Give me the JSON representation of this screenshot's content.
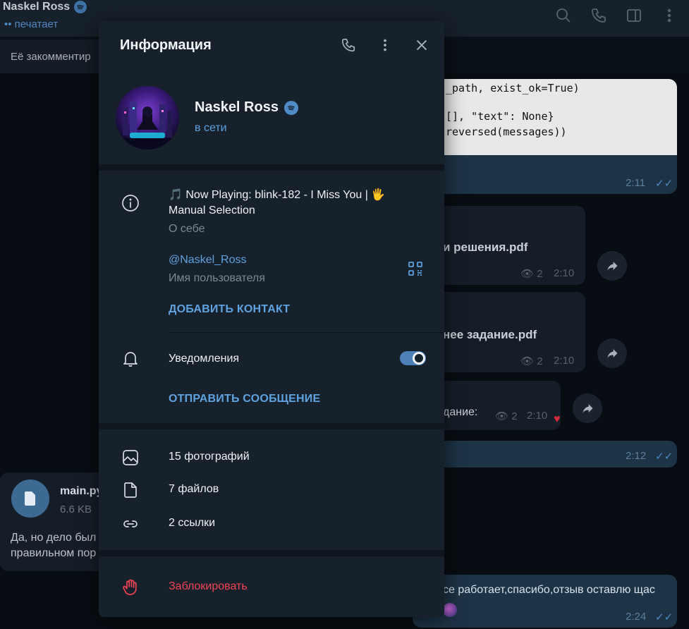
{
  "background": {
    "chat_title": "Naskel Ross",
    "chat_status": "•• печатает",
    "pinned_preview": "Её закомментир",
    "code_lines": [
      "_path, exist_ok=True)",
      "[], \"text\": None}",
      "reversed(messages))"
    ],
    "times": [
      "2:11",
      "2:10",
      "2:10",
      "2:10",
      "2:12",
      "2:24"
    ],
    "view_counts": [
      "2",
      "2",
      "2"
    ],
    "file_names": [
      "и решения.pdf",
      "нее задание.pdf"
    ],
    "partial_task": "дание:",
    "main_file_name": "main.py",
    "main_file_size": "6.6 KB",
    "incoming_text": [
      "Да, но дело был",
      "правильном пор"
    ],
    "last_message": "се работает,спасибо,отзыв оставлю щас"
  },
  "panel": {
    "title": "Информация",
    "name": "Naskel Ross",
    "status": "в сети",
    "bio_line1": "🎵 Now Playing: blink-182 - I Miss You | 🖐",
    "bio_line2": "Manual Selection",
    "bio_label": "О себе",
    "username": "@Naskel_Ross",
    "username_label": "Имя пользователя",
    "add_contact": "ДОБАВИТЬ КОНТАКТ",
    "notifications": "Уведомления",
    "notifications_on": true,
    "send_message": "ОТПРАВИТЬ СООБЩЕНИЕ",
    "photos": "15 фотографий",
    "files": "7 файлов",
    "links": "2 ссылки",
    "block": "Заблокировать"
  },
  "colors": {
    "accent": "#5ea2e0",
    "panel_bg": "#17212b",
    "danger": "#ef4452",
    "toggle": "#4d80b9"
  },
  "icons": [
    "phone-icon",
    "more-vertical-icon",
    "close-icon",
    "info-icon",
    "qr-code-icon",
    "bell-icon",
    "photo-icon",
    "file-icon",
    "link-icon",
    "hand-block-icon",
    "spotify-icon",
    "share-icon",
    "search-icon",
    "sidebar-icon"
  ]
}
